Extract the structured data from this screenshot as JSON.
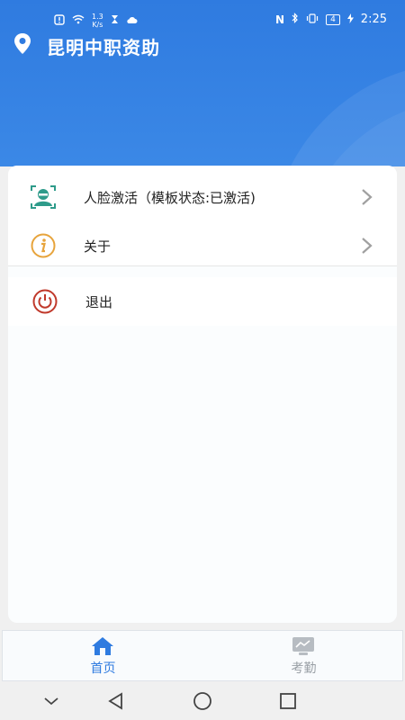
{
  "status_bar": {
    "network_speed_value": "1.3",
    "network_speed_unit": "K/s",
    "nfc": "N",
    "battery_level": "4",
    "time": "2:25"
  },
  "header": {
    "title": "昆明中职资助",
    "location_icon": "location-pin-icon"
  },
  "menu": {
    "items": [
      {
        "label": "人脸激活（模板状态:已激活)",
        "icon": "face-scan-icon"
      },
      {
        "label": "关于",
        "icon": "info-icon"
      }
    ],
    "logout": {
      "label": "退出",
      "icon": "power-icon"
    }
  },
  "tabbar": {
    "tabs": [
      {
        "label": "首页",
        "icon": "home-icon",
        "active": true
      },
      {
        "label": "考勤",
        "icon": "attendance-icon",
        "active": false
      }
    ]
  },
  "system_nav": [
    "collapse-icon",
    "back-icon",
    "home-circle-icon",
    "recents-icon"
  ],
  "colors": {
    "primary": "#2f7be0",
    "face_icon": "#2e9b8a",
    "info_icon": "#e7a43c",
    "logout_icon": "#c0392b",
    "inactive_tab": "#9aa0a6"
  }
}
